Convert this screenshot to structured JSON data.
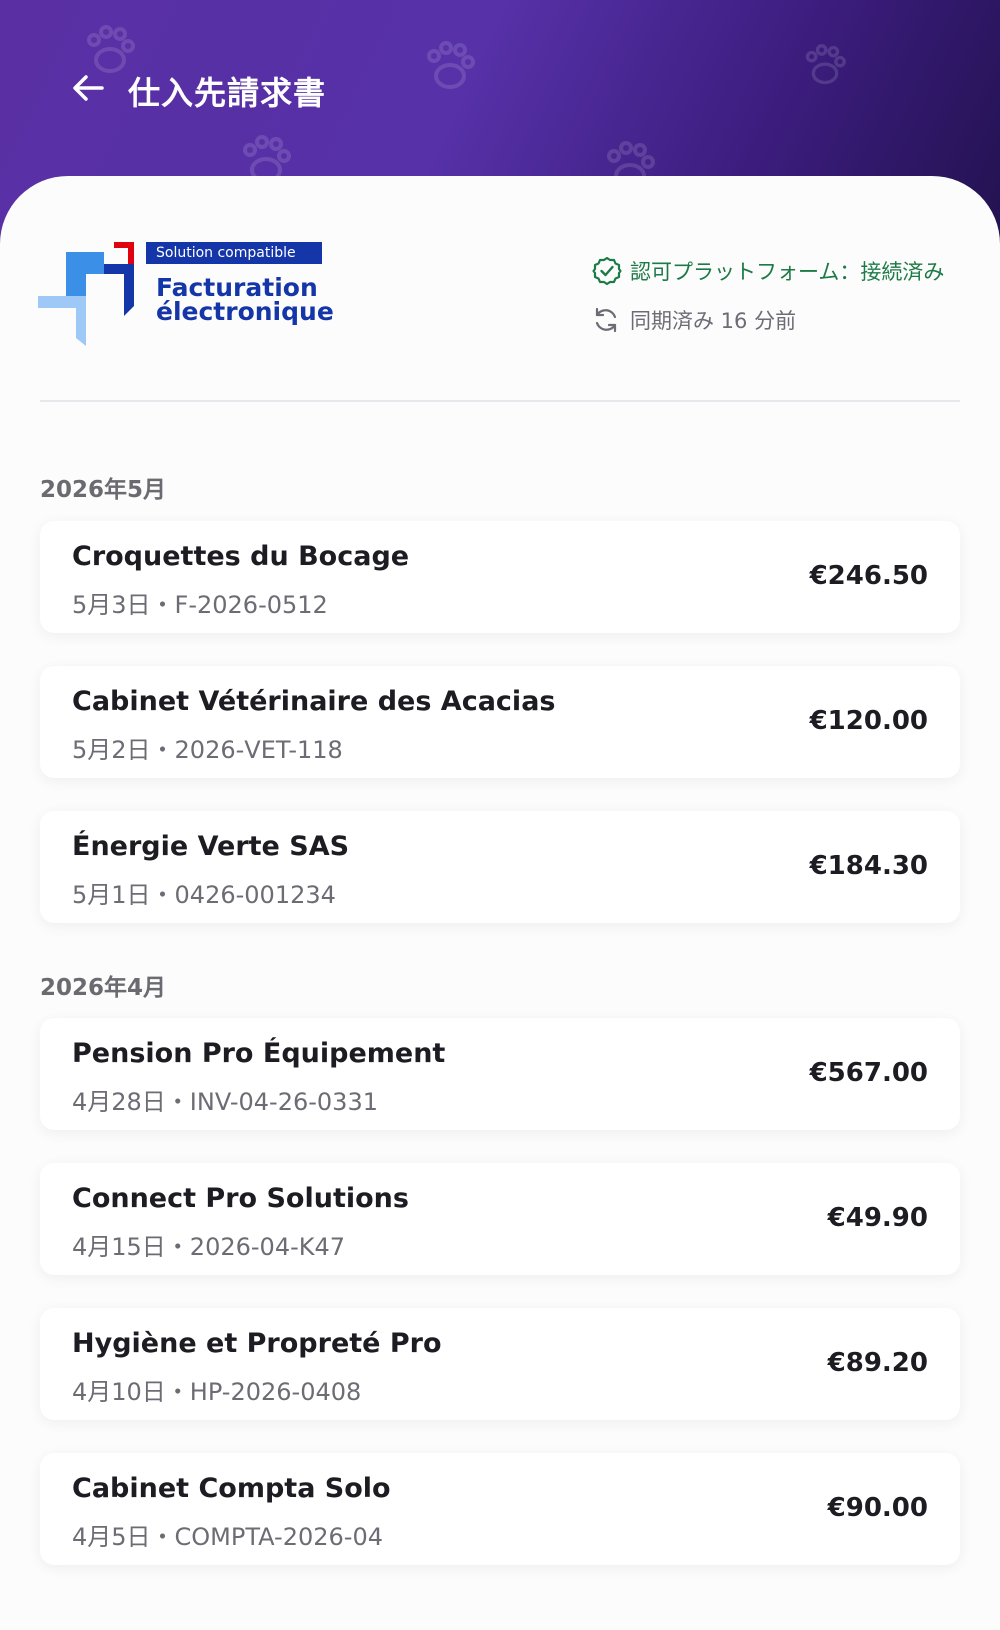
{
  "header": {
    "title": "仕入先請求書",
    "back_icon": "arrow-left-icon"
  },
  "logo": {
    "badge": "Solution compatible",
    "line1": "Facturation",
    "line2": "électronique"
  },
  "status": {
    "connected": "認可プラットフォーム：接続済み",
    "synced": "同期済み 16 分前"
  },
  "colors": {
    "header_start": "#5a2fa4",
    "header_end": "#22124f",
    "success": "#1c7a46",
    "logo_blue": "#1436a8",
    "logo_red": "#e1000f"
  },
  "groups": [
    {
      "month": "2026年5月",
      "invoices": [
        {
          "vendor": "Croquettes du Bocage",
          "meta": "5月3日・F-2026-0512",
          "amount": "€246.50"
        },
        {
          "vendor": "Cabinet Vétérinaire des Acacias",
          "meta": "5月2日・2026-VET-118",
          "amount": "€120.00"
        },
        {
          "vendor": "Énergie Verte SAS",
          "meta": "5月1日・0426-001234",
          "amount": "€184.30"
        }
      ]
    },
    {
      "month": "2026年4月",
      "invoices": [
        {
          "vendor": "Pension Pro Équipement",
          "meta": "4月28日・INV-04-26-0331",
          "amount": "€567.00"
        },
        {
          "vendor": "Connect Pro Solutions",
          "meta": "4月15日・2026-04-K47",
          "amount": "€49.90"
        },
        {
          "vendor": "Hygiène et Propreté Pro",
          "meta": "4月10日・HP-2026-0408",
          "amount": "€89.20"
        },
        {
          "vendor": "Cabinet Compta Solo",
          "meta": "4月5日・COMPTA-2026-04",
          "amount": "€90.00"
        }
      ]
    }
  ]
}
